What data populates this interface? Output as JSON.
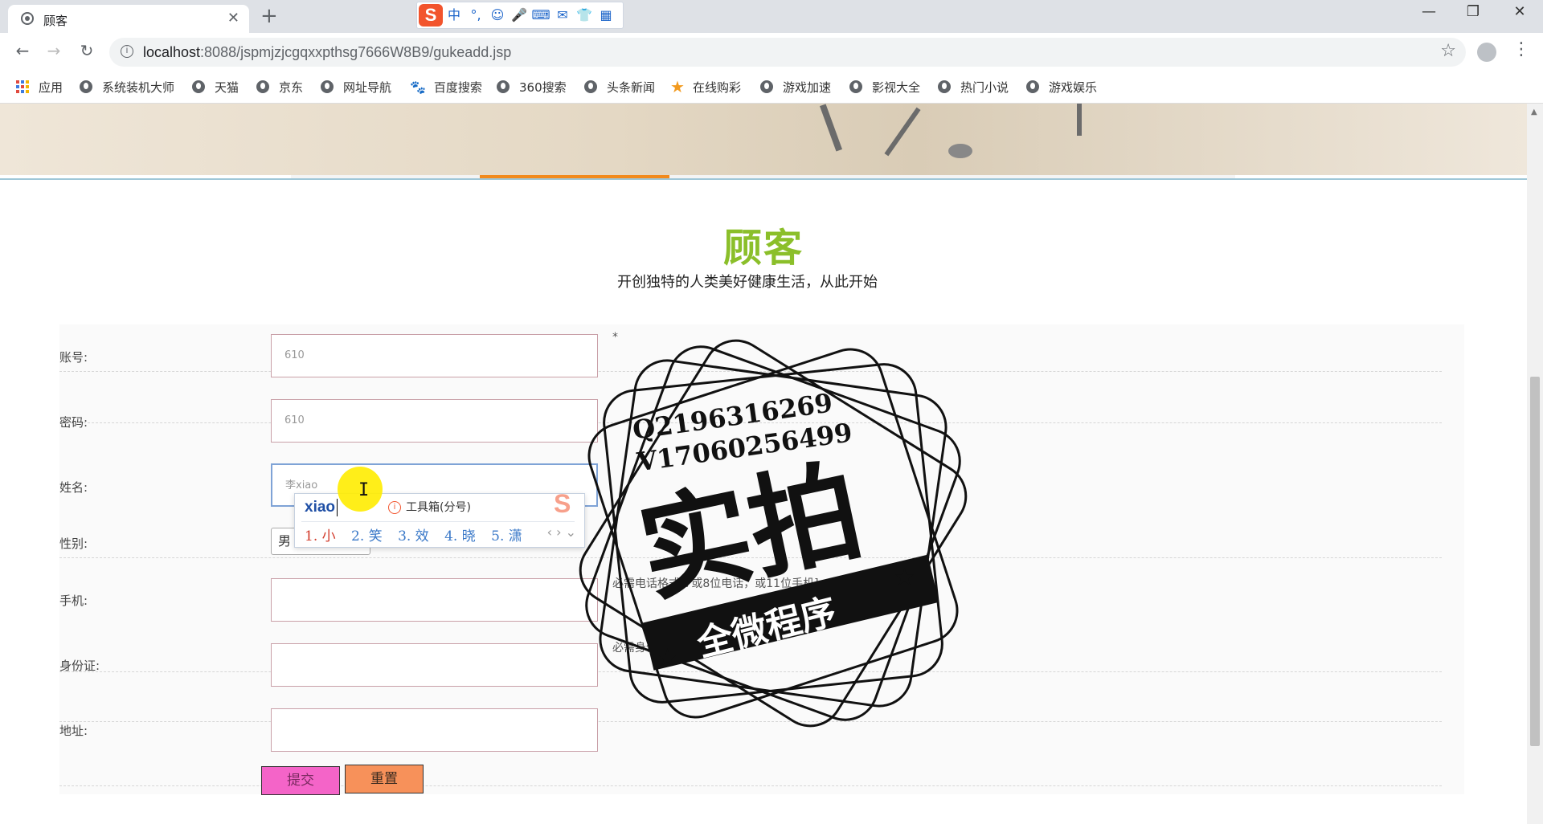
{
  "browser": {
    "tab_title": "顾客",
    "url_host": "localhost",
    "url_rest": ":8088/jspmjzjcgqxxpthsg7666W8B9/gukeadd.jsp",
    "bookmarks": [
      "应用",
      "系统装机大师",
      "天猫",
      "京东",
      "网址导航",
      "百度搜索",
      "360搜索",
      "头条新闻",
      "在线购彩",
      "游戏加速",
      "影视大全",
      "热门小说",
      "游戏娱乐"
    ],
    "ime_toolbar": [
      "中",
      "°,",
      "☺",
      "🎤",
      "⌨",
      "✉",
      "👕",
      "▦"
    ]
  },
  "page": {
    "title": "顾客",
    "subtitle": "开创独特的人类美好健康生活，从此开始"
  },
  "form": {
    "account_label": "账号:",
    "account_value": "610",
    "account_req": "*",
    "password_label": "密码:",
    "password_value": "610",
    "name_label": "姓名:",
    "name_value": "李xiao",
    "gender_label": "性别:",
    "gender_value": "男",
    "phone_label": "手机:",
    "phone_hint": "必需电话格式[7或8位电话，或11位手机]",
    "idcard_label": "身份证:",
    "idcard_hint": "必需身份证格式",
    "address_label": "地址:",
    "submit_label": "提交",
    "reset_label": "重置"
  },
  "ime": {
    "typed": "xiao",
    "toolbox": "工具箱(分号)",
    "candidates": [
      "1. 小",
      "2. 笑",
      "3. 效",
      "4. 晓",
      "5. 潇"
    ],
    "pager": "‹ › ⌄"
  },
  "watermark": {
    "line1": "Q2196316269",
    "line2": "V17060256499",
    "big": "实拍",
    "banner": "全微程序"
  },
  "colors": {
    "title_green": "#8bbf2a",
    "nav_active": "#f28a1c",
    "submit_bg": "#f464c8",
    "reset_bg": "#f7915a"
  }
}
